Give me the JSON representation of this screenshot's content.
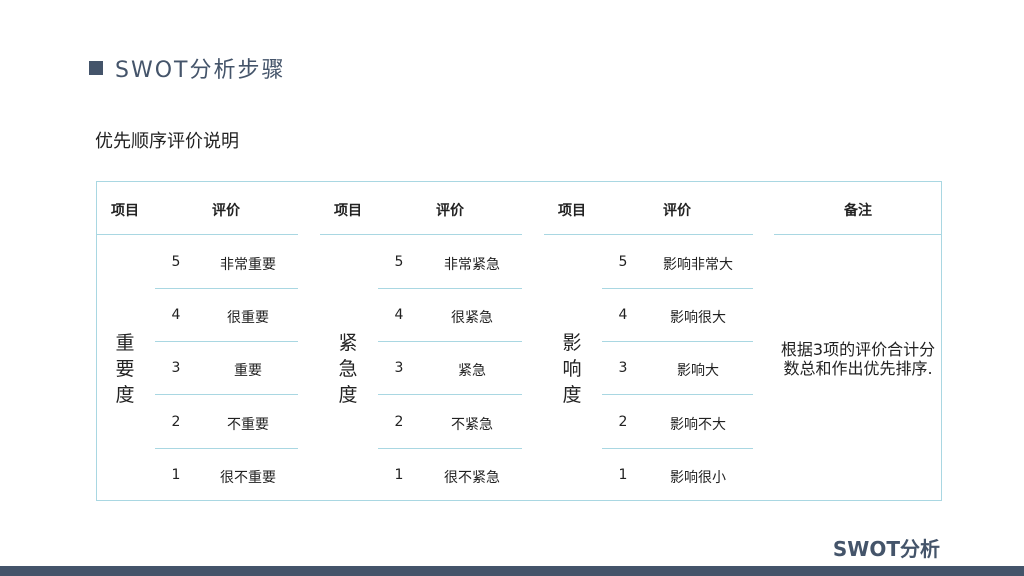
{
  "slide": {
    "title": "SWOT分析步骤",
    "subtitle": "优先顺序评价说明",
    "brand": "SWOT分析"
  },
  "table": {
    "headers": {
      "item": "项目",
      "rating": "评价",
      "note": "备注"
    },
    "groups": [
      {
        "label_chars": [
          "重",
          "要",
          "度"
        ],
        "rows": [
          {
            "score": "5",
            "desc": "非常重要"
          },
          {
            "score": "4",
            "desc": "很重要"
          },
          {
            "score": "3",
            "desc": "重要"
          },
          {
            "score": "2",
            "desc": "不重要"
          },
          {
            "score": "1",
            "desc": "很不重要"
          }
        ]
      },
      {
        "label_chars": [
          "紧",
          "急",
          "度"
        ],
        "rows": [
          {
            "score": "5",
            "desc": "非常紧急"
          },
          {
            "score": "4",
            "desc": "很紧急"
          },
          {
            "score": "3",
            "desc": "紧急"
          },
          {
            "score": "2",
            "desc": "不紧急"
          },
          {
            "score": "1",
            "desc": "很不紧急"
          }
        ]
      },
      {
        "label_chars": [
          "影",
          "响",
          "度"
        ],
        "rows": [
          {
            "score": "5",
            "desc": "影响非常大"
          },
          {
            "score": "4",
            "desc": "影响很大"
          },
          {
            "score": "3",
            "desc": "影响大"
          },
          {
            "score": "2",
            "desc": "影响不大"
          },
          {
            "score": "1",
            "desc": "影响很小"
          }
        ]
      }
    ],
    "note": "根据3项的评价合计分数总和作出优先排序."
  }
}
